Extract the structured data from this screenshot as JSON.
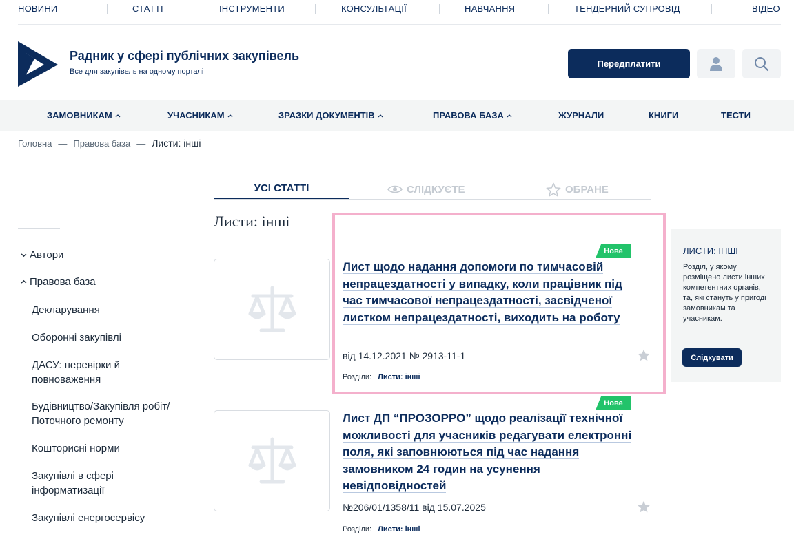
{
  "top_nav": [
    "НОВИНИ",
    "СТАТТІ",
    "ІНСТРУМЕНТИ",
    "КОНСУЛЬТАЦІЇ",
    "НАВЧАННЯ",
    "ТЕНДЕРНИЙ СУПРОВІД",
    "ВІДЕО"
  ],
  "brand": {
    "title": "Радник у сфері публічних закупівель",
    "subtitle": "Все для закупівель на одному порталі"
  },
  "header": {
    "subscribe_label": "Передплатити",
    "user_icon": "user-icon",
    "search_icon": "search-icon"
  },
  "main_nav": [
    "ЗАМОВНИКАМ",
    "УЧАСНИКАМ",
    "ЗРАЗКИ ДОКУМЕНТІВ",
    "ПРАВОВА БАЗА",
    "ЖУРНАЛИ",
    "КНИГИ",
    "ТЕСТИ"
  ],
  "breadcrumb": [
    "Головна",
    "Правова база",
    "Листи: інші"
  ],
  "tabs": {
    "all": "УСІ СТАТТІ",
    "following": "СЛІДКУЄТЕ",
    "favorites": "ОБРАНЕ"
  },
  "page_title": "Листи: інші",
  "sidebar": {
    "groups": [
      {
        "label": "Автори",
        "state": "collapsed"
      },
      {
        "label": "Правова база",
        "state": "expanded"
      }
    ],
    "items": [
      "Декларування",
      "Оборонні закупівлі",
      "ДАСУ: перевірки й повноваження",
      "Будівництво/Закупівля робіт/Поточного ремонту",
      "Кошторисні норми",
      "Закупівлі в сфері інформатизації",
      "Закупівлі енергосервісу"
    ]
  },
  "articles": [
    {
      "badge": "Нове",
      "title": "Лист щодо надання допомоги по тимчасовій непрацездатності у випадку, коли працівник під час тимчасової непрацездатності, засвідченої листком непрацездатності, виходить на роботу",
      "meta": "від 14.12.2021 № 2913-11-1",
      "sections_label": "Розділи:",
      "section": "Листи: інші"
    },
    {
      "badge": "Нове",
      "title": "Лист ДП “ПРОЗОРРО” щодо реалізації технічної можливості для учасників редагувати електронні поля, які заповнюються під час надання замовником 24 годин на усунення невідповідностей",
      "meta": "№206/01/1358/11 від 15.07.2025",
      "sections_label": "Розділи:",
      "section": "Листи: інші"
    }
  ],
  "right_panel": {
    "title": "ЛИСТИ: ІНШІ",
    "description": "Розділ, у якому розміщено листи інших компетентних органів, та, які стануть у пригоді замовникам та учасникам.",
    "follow_label": "Слідкувати"
  },
  "colors": {
    "brand": "#0c2c5c",
    "badge": "#22c36a",
    "highlight": "#f4b0cc",
    "panel_bg": "#f3f5f5"
  }
}
